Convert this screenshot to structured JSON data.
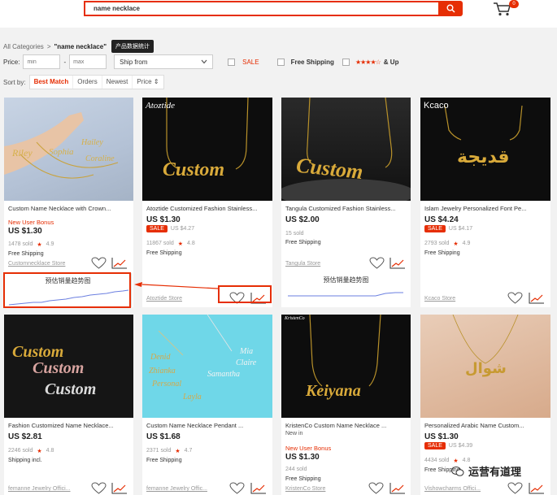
{
  "header": {
    "search_value": "name necklace",
    "cart_count": "0"
  },
  "breadcrumb": {
    "root": "All Categories",
    "sep": ">",
    "current": "\"name necklace\"",
    "tooltip": "产品数据统计"
  },
  "filters": {
    "price_label": "Price:",
    "min_placeholder": "min",
    "dash": "-",
    "max_placeholder": "max",
    "ship_from": "Ship from",
    "sale": "SALE",
    "free_shipping": "Free Shipping",
    "stars": "★★★★☆",
    "and_up": "& Up"
  },
  "sort": {
    "label": "Sort by:",
    "options": [
      "Best Match",
      "Orders",
      "Newest",
      "Price ⇕"
    ]
  },
  "products": [
    {
      "title": "Custom Name Necklace with Crown...",
      "badge": "New User Bonus",
      "price": "US $1.30",
      "sold": "1478 sold",
      "rating": "4.9",
      "shipping": "Free Shipping",
      "store": "Customnecklace Store"
    },
    {
      "img_text": "Atoztide",
      "title": "Atoztide Customized Fashion Stainless...",
      "price": "US $1.30",
      "sale": "SALE",
      "orig": "US $4.27",
      "sold": "11867 sold",
      "rating": "4.8",
      "shipping": "Free Shipping",
      "store": "Atoztide Store"
    },
    {
      "title": "Tangula Customized Fashion Stainless...",
      "price": "US $2.00",
      "sold": "15 sold",
      "shipping": "Free Shipping",
      "store": "Tangula Store"
    },
    {
      "img_text": "Kcaco",
      "title": "Islam Jewelry Personalized Font Pe...",
      "price": "US $4.24",
      "sale": "SALE",
      "orig": "US $4.17",
      "sold": "2793 sold",
      "rating": "4.9",
      "shipping": "Free Shipping",
      "store": "Kcaco Store"
    },
    {
      "title": "Fashion Customized Name Necklace...",
      "price": "US $2.81",
      "sold": "2246 sold",
      "rating": "4.8",
      "shipping": "Shipping incl.",
      "store": "femanne Jewelry Offici..."
    },
    {
      "title": "Custom Name Necklace Pendant ...",
      "price": "US $1.68",
      "sold": "2371 sold",
      "rating": "4.7",
      "shipping": "Free Shipping",
      "store": "femanne Jewelry Offic..."
    },
    {
      "img_text": "KristenCo",
      "title": "KristenCo Custom Name Necklace ...",
      "subtitle": "New in",
      "badge": "New User Bonus",
      "price": "US $1.30",
      "sold": "244 sold",
      "shipping": "Free Shipping",
      "store": "KristenCo Store"
    },
    {
      "title": "Personalized Arabic Name Custom...",
      "price": "US $1.30",
      "sale": "SALE",
      "orig": "US $4.39",
      "sold": "4434 sold",
      "rating": "4.8",
      "shipping": "Free Shipping",
      "store": "Vishowcharms Offici..."
    }
  ],
  "trend": {
    "title": "预估销量趋势图"
  },
  "watermark": "运营有道理",
  "colors": {
    "accent": "#e62e04",
    "trend_line": "#6b7fe0"
  }
}
